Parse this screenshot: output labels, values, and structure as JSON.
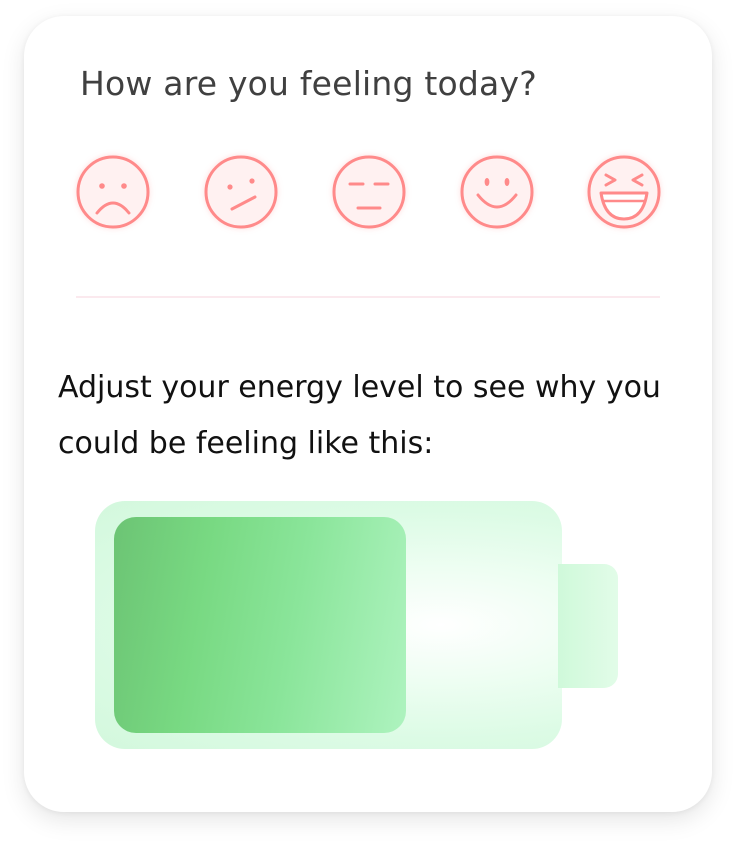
{
  "question": "How are you feeling today?",
  "moods": [
    {
      "icon": "very-sad-face-icon"
    },
    {
      "icon": "confused-face-icon"
    },
    {
      "icon": "neutral-face-icon"
    },
    {
      "icon": "smiling-face-icon"
    },
    {
      "icon": "laughing-face-icon"
    }
  ],
  "prompt": "Adjust your energy level to see why you could be feeling like this:",
  "energy": {
    "level": 0.68,
    "color": "#7ad988"
  },
  "colors": {
    "face_stroke": "#ff8a8a",
    "face_fill": "#fff1f1"
  }
}
